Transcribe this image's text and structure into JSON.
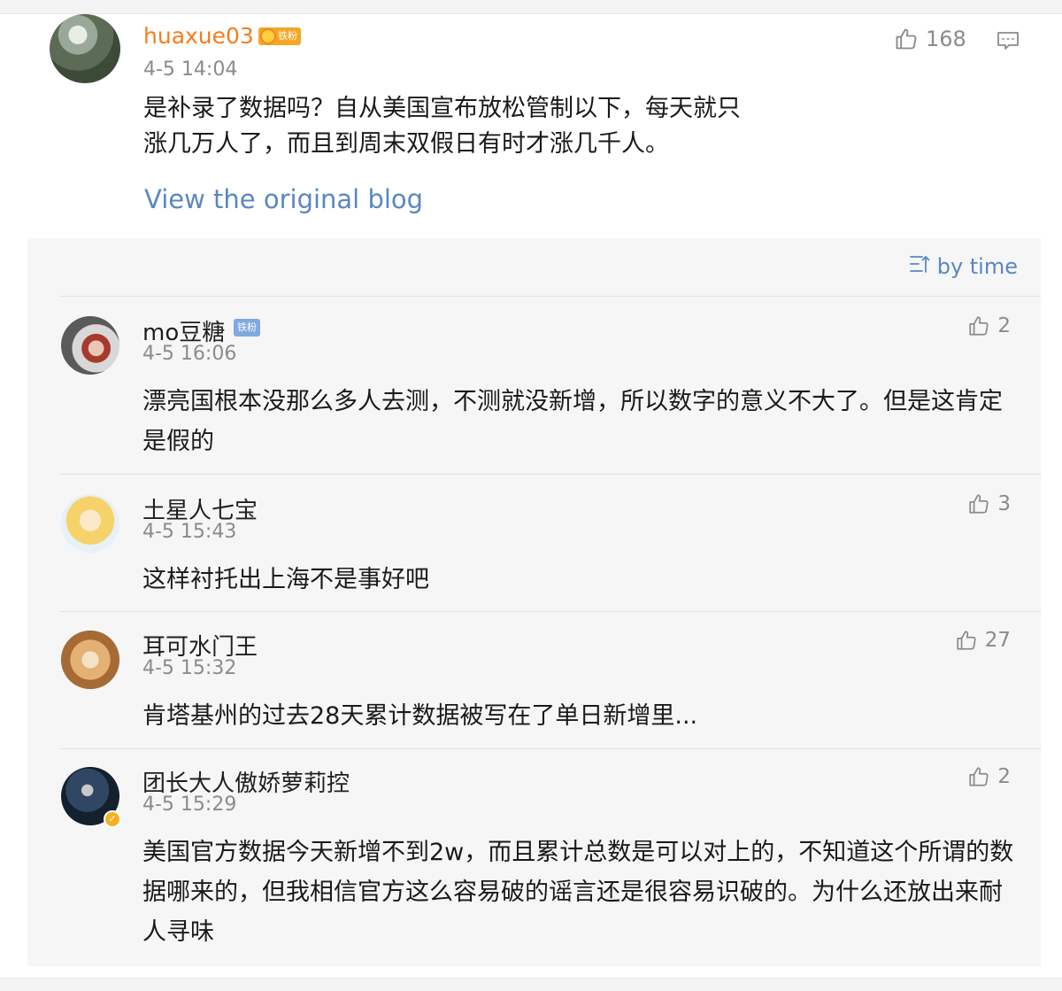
{
  "main_comment": {
    "username": "huaxue03",
    "badge": "铁粉",
    "time": "4-5 14:04",
    "likes": "168",
    "text": "是补录了数据吗？自从美国宣布放松管制以下，每天就只涨几万人了，而且到周末双假日有时才涨几千人。",
    "view_link": "View the original blog"
  },
  "replies_panel": {
    "sort_label": "by time",
    "items": [
      {
        "username": "mo豆糖",
        "badge": "铁粉",
        "time": "4-5 16:06",
        "likes": "2",
        "text": "漂亮国根本没那么多人去测，不测就没新增，所以数字的意义不大了。但是这肯定是假的"
      },
      {
        "username": "土星人七宝",
        "time": "4-5 15:43",
        "likes": "3",
        "text": "这样衬托出上海不是事好吧"
      },
      {
        "username": "耳可水门王",
        "time": "4-5 15:32",
        "likes": "27",
        "text": "肯塔基州的过去28天累计数据被写在了单日新增里..."
      },
      {
        "username": "团长大人傲娇萝莉控",
        "time": "4-5 15:29",
        "likes": "2",
        "text": "美国官方数据今天新增不到2w，而且累计总数是可以对上的，不知道这个所谓的数据哪来的，但我相信官方这么容易破的谣言还是很容易识破的。为什么还放出来耐人寻味"
      }
    ]
  },
  "colors": {
    "username_highlight": "#f37e1e",
    "link": "#5a87c0",
    "muted": "#8b8b8b",
    "panel_bg": "#f6f6f6"
  },
  "icons": [
    "thumb-up-icon",
    "message-icon",
    "sort-icon",
    "verified-icon",
    "crown-icon"
  ]
}
